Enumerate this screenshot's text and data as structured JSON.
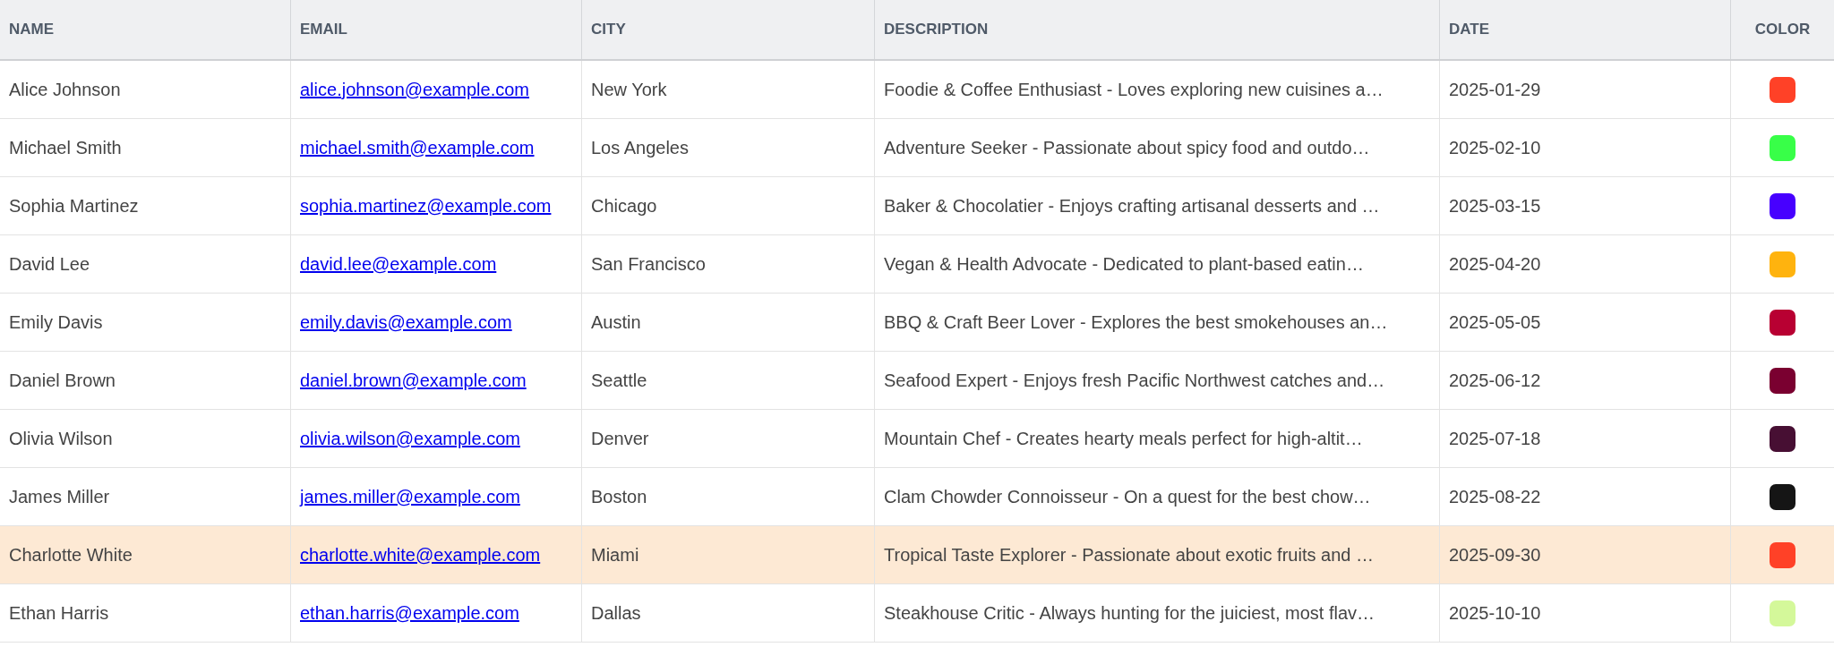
{
  "table": {
    "columns": [
      "NAME",
      "EMAIL",
      "CITY",
      "DESCRIPTION",
      "DATE",
      "COLOR"
    ],
    "rows": [
      {
        "name": "Alice Johnson",
        "email": "alice.johnson@example.com",
        "city": "New York",
        "description": "Foodie & Coffee Enthusiast - Loves exploring new cuisines a…",
        "date": "2025-01-29",
        "color": "#ff4127",
        "selected": false
      },
      {
        "name": "Michael Smith",
        "email": "michael.smith@example.com",
        "city": "Los Angeles",
        "description": "Adventure Seeker - Passionate about spicy food and outdo…",
        "date": "2025-02-10",
        "color": "#38ff48",
        "selected": false
      },
      {
        "name": "Sophia Martinez",
        "email": "sophia.martinez@example.com",
        "city": "Chicago",
        "description": "Baker & Chocolatier - Enjoys crafting artisanal desserts and …",
        "date": "2025-03-15",
        "color": "#4700ff",
        "selected": false
      },
      {
        "name": "David Lee",
        "email": "david.lee@example.com",
        "city": "San Francisco",
        "description": "Vegan & Health Advocate - Dedicated to plant-based eatin…",
        "date": "2025-04-20",
        "color": "#ffb30e",
        "selected": false
      },
      {
        "name": "Emily Davis",
        "email": "emily.davis@example.com",
        "city": "Austin",
        "description": "BBQ & Craft Beer Lover - Explores the best smokehouses an…",
        "date": "2025-05-05",
        "color": "#b80032",
        "selected": false
      },
      {
        "name": "Daniel Brown",
        "email": "daniel.brown@example.com",
        "city": "Seattle",
        "description": "Seafood Expert - Enjoys fresh Pacific Northwest catches and…",
        "date": "2025-06-12",
        "color": "#7a0030",
        "selected": false
      },
      {
        "name": "Olivia Wilson",
        "email": "olivia.wilson@example.com",
        "city": "Denver",
        "description": "Mountain Chef - Creates hearty meals perfect for high-altit…",
        "date": "2025-07-18",
        "color": "#470f33",
        "selected": false
      },
      {
        "name": "James Miller",
        "email": "james.miller@example.com",
        "city": "Boston",
        "description": "Clam Chowder Connoisseur - On a quest for the best chow…",
        "date": "2025-08-22",
        "color": "#151515",
        "selected": false
      },
      {
        "name": "Charlotte White",
        "email": "charlotte.white@example.com",
        "city": "Miami",
        "description": "Tropical Taste Explorer - Passionate about exotic fruits and …",
        "date": "2025-09-30",
        "color": "#ff4127",
        "selected": true
      },
      {
        "name": "Ethan Harris",
        "email": "ethan.harris@example.com",
        "city": "Dallas",
        "description": "Steakhouse Critic - Always hunting for the juiciest, most flav…",
        "date": "2025-10-10",
        "color": "#d4f89a",
        "selected": false
      }
    ]
  }
}
